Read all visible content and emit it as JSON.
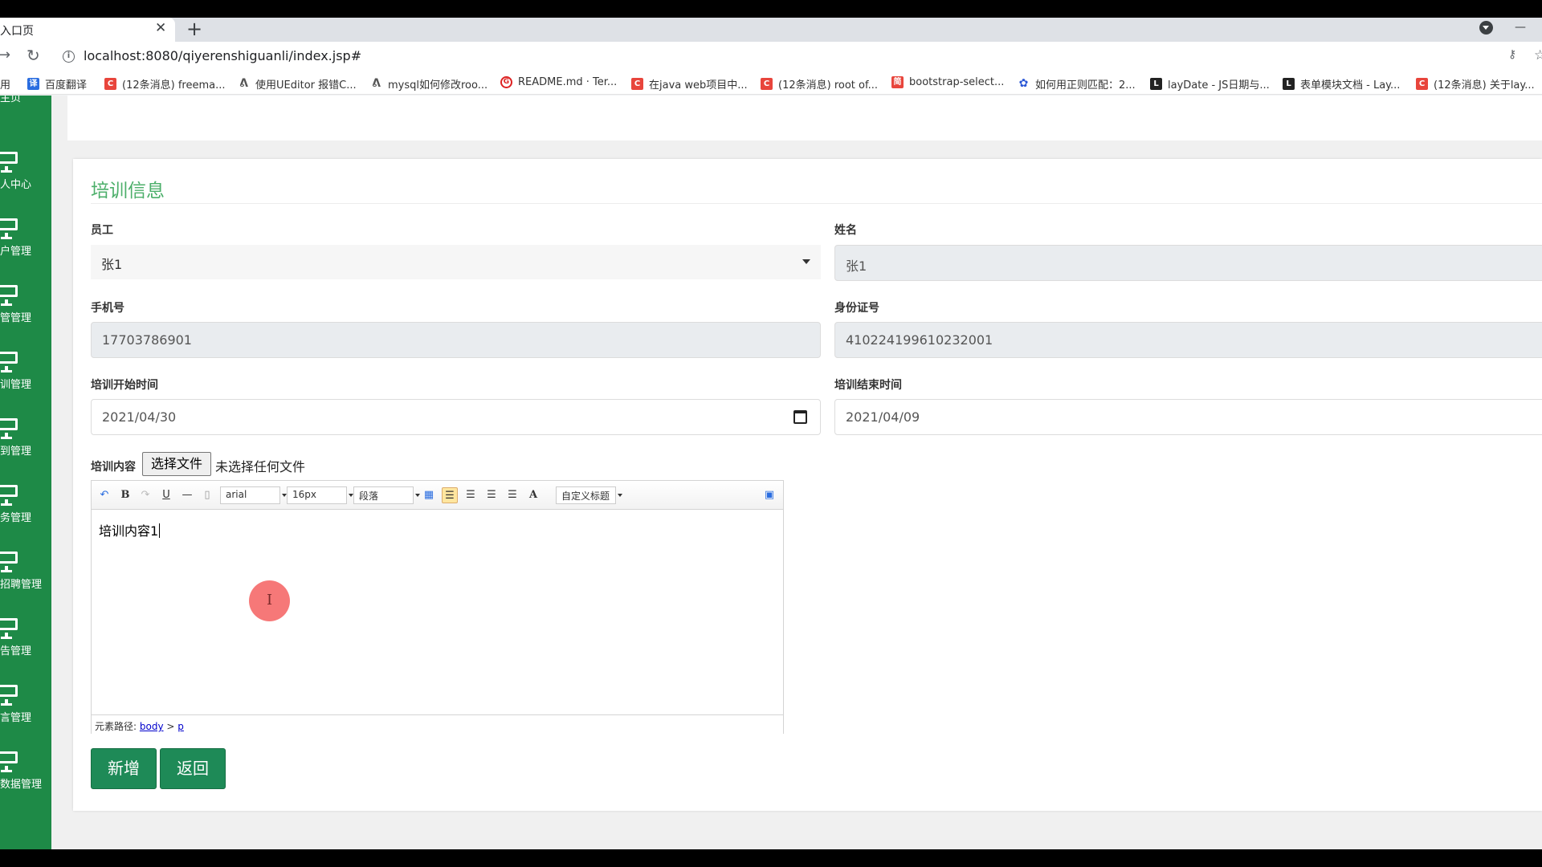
{
  "browser": {
    "tab_title": "入口页",
    "tab_close": "✕",
    "new_tab": "+",
    "minimize": "—",
    "url": "localhost:8080/qiyerenshiguanli/index.jsp#",
    "bookmarks": [
      {
        "label": "用",
        "icon": "apps-icon"
      },
      {
        "label": "百度翻译",
        "icon": "baidu-translate-icon"
      },
      {
        "label": "(12条消息) freema...",
        "icon": "csdn-icon"
      },
      {
        "label": "使用UEditor 报错C...",
        "icon": "bookmark-icon"
      },
      {
        "label": "mysql如何修改roo...",
        "icon": "bookmark-icon"
      },
      {
        "label": "README.md · Ter...",
        "icon": "gitee-icon"
      },
      {
        "label": "在java web项目中...",
        "icon": "csdn-icon"
      },
      {
        "label": "(12条消息) root of...",
        "icon": "csdn-icon"
      },
      {
        "label": "bootstrap-select...",
        "icon": "jianshu-icon"
      },
      {
        "label": "如何用正则匹配：2...",
        "icon": "baidu-icon"
      },
      {
        "label": "layDate - JS日期与...",
        "icon": "layui-icon"
      },
      {
        "label": "表单模块文档 - Lay...",
        "icon": "layui-icon"
      },
      {
        "label": "(12条消息) 关于lay...",
        "icon": "csdn-icon"
      }
    ]
  },
  "sidebar": {
    "top_label": "主页",
    "items": [
      {
        "label": "人中心"
      },
      {
        "label": "户管理"
      },
      {
        "label": "管管理"
      },
      {
        "label": "训管理"
      },
      {
        "label": "到管理"
      },
      {
        "label": "务管理"
      },
      {
        "label": "招聘管理"
      },
      {
        "label": "告管理"
      },
      {
        "label": "言管理"
      },
      {
        "label": "数据管理"
      }
    ]
  },
  "form": {
    "title": "培训信息",
    "employee_label": "员工",
    "employee_value": "张1",
    "name_label": "姓名",
    "name_value": "张1",
    "phone_label": "手机号",
    "phone_value": "17703786901",
    "idcard_label": "身份证号",
    "idcard_value": "410224199610232001",
    "start_label": "培训开始时间",
    "start_value": "2021/04/30",
    "end_label": "培训结束时间",
    "end_value": "2021/04/09",
    "content_label": "培训内容",
    "file_button": "选择文件",
    "file_status": "未选择任何文件",
    "add_button": "新增",
    "back_button": "返回"
  },
  "editor": {
    "font_family": "arial",
    "font_size": "16px",
    "paragraph": "段落",
    "custom_title": "自定义标题",
    "content": "培训内容1",
    "path_label": "元素路径:",
    "path_body": "body",
    "path_sep": ">",
    "path_p": "p"
  }
}
